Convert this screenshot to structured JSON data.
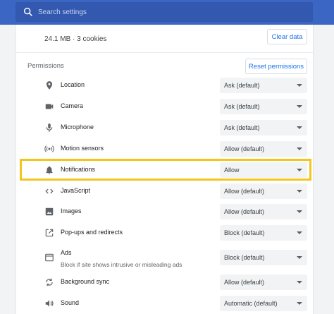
{
  "search": {
    "placeholder": "Search settings"
  },
  "site_data": {
    "storage": "24.1 MB · 3 cookies",
    "clear_label": "Clear data"
  },
  "permissions": {
    "heading": "Permissions",
    "reset_label": "Reset permissions",
    "items": [
      {
        "label": "Location",
        "icon": "location-pin-icon",
        "value": "Ask (default)"
      },
      {
        "label": "Camera",
        "icon": "camera-icon",
        "value": "Ask (default)"
      },
      {
        "label": "Microphone",
        "icon": "microphone-icon",
        "value": "Ask (default)"
      },
      {
        "label": "Motion sensors",
        "icon": "motion-sensors-icon",
        "value": "Allow (default)"
      },
      {
        "label": "Notifications",
        "icon": "bell-icon",
        "value": "Allow",
        "highlighted": true
      },
      {
        "label": "JavaScript",
        "icon": "code-icon",
        "value": "Allow (default)"
      },
      {
        "label": "Images",
        "icon": "image-icon",
        "value": "Allow (default)"
      },
      {
        "label": "Pop-ups and redirects",
        "icon": "popup-icon",
        "value": "Block (default)"
      },
      {
        "label": "Ads",
        "sublabel": "Block if site shows intrusive or misleading ads",
        "icon": "ads-icon",
        "value": "Block (default)"
      },
      {
        "label": "Background sync",
        "icon": "sync-icon",
        "value": "Allow (default)"
      },
      {
        "label": "Sound",
        "icon": "speaker-icon",
        "value": "Automatic (default)"
      }
    ]
  },
  "colors": {
    "header": "#3b66c4",
    "accent": "#1a73e8",
    "highlight": "#f4c51e"
  }
}
